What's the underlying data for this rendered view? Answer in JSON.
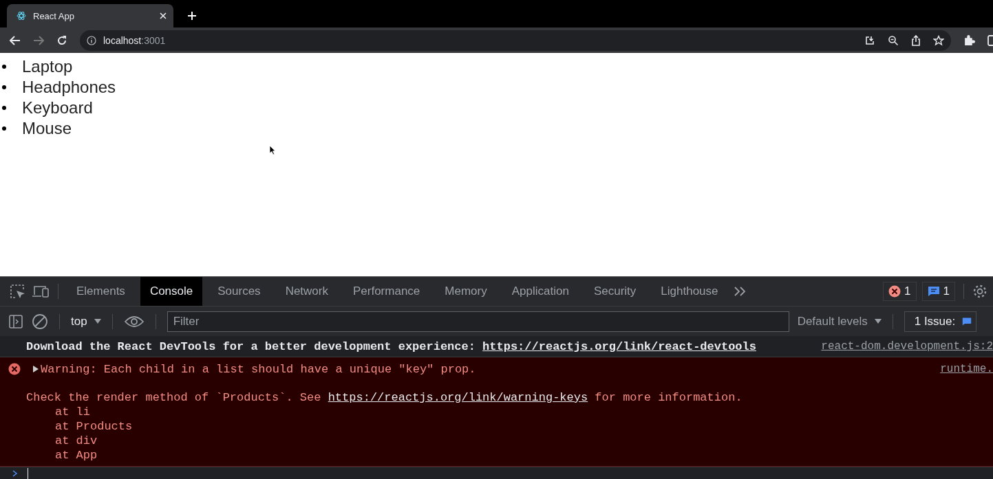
{
  "browser": {
    "tab_title": "React App",
    "url_host": "localhost",
    "url_port": ":3001"
  },
  "page": {
    "items": [
      "Laptop",
      "Headphones",
      "Keyboard",
      "Mouse"
    ]
  },
  "devtools": {
    "tabs": [
      {
        "label": "Elements",
        "selected": false
      },
      {
        "label": "Console",
        "selected": true
      },
      {
        "label": "Sources",
        "selected": false
      },
      {
        "label": "Network",
        "selected": false
      },
      {
        "label": "Performance",
        "selected": false
      },
      {
        "label": "Memory",
        "selected": false
      },
      {
        "label": "Application",
        "selected": false
      },
      {
        "label": "Security",
        "selected": false
      },
      {
        "label": "Lighthouse",
        "selected": false
      }
    ],
    "error_count": "1",
    "message_count": "1",
    "context": "top",
    "filter": {
      "placeholder": "Filter"
    },
    "levels": "Default levels",
    "issues": "1 Issue:",
    "messages": [
      {
        "kind": "info",
        "text": "Download the React DevTools for a better development experience: ",
        "link": "https://reactjs.org/link/react-devtools",
        "source": "react-dom.development.js:2"
      },
      {
        "kind": "error",
        "expanded": false,
        "text": "Warning: Each child in a list should have a unique \"key\" prop.",
        "source": "runtime.",
        "detail_before": "Check the render method of `Products`. See ",
        "link": "https://reactjs.org/link/warning-keys",
        "detail_after": " for more information.",
        "stack": [
          "at li",
          "at Products",
          "at div",
          "at App"
        ]
      }
    ]
  }
}
